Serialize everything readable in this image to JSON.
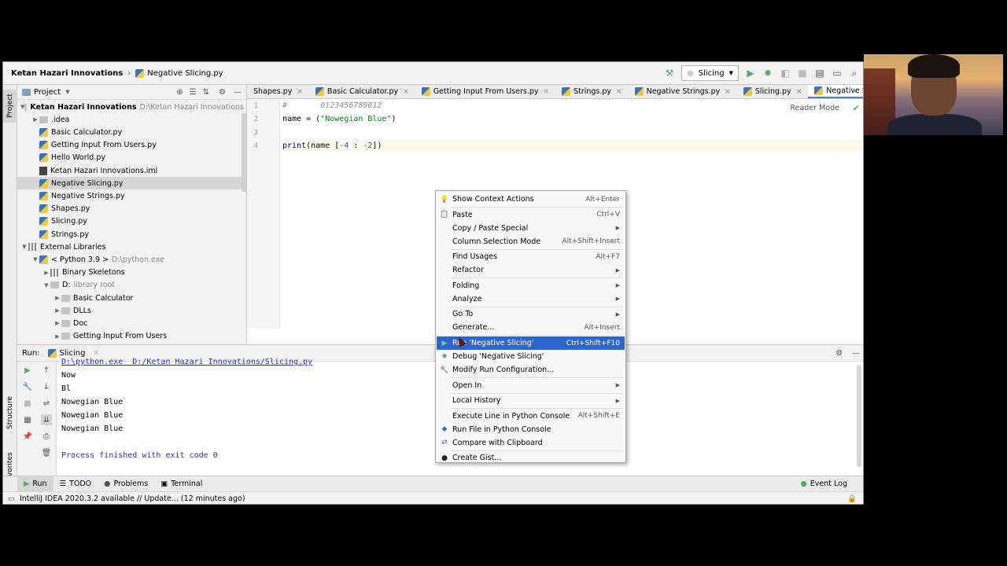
{
  "navbar": {
    "project": "Ketan Hazari Innovations",
    "file": "Negative Slicing.py",
    "run_config": "Slicing"
  },
  "left_strip": {
    "project": "Project",
    "structure": "Structure",
    "favorites": "Favorites"
  },
  "project_panel": {
    "title": "Project",
    "tree": [
      {
        "label": "Ketan Hazari Innovations",
        "note": "D:\\Ketan Hazari Innovations",
        "level": 0,
        "kind": "root",
        "expanded": true
      },
      {
        "label": ".idea",
        "level": 1,
        "kind": "folder",
        "expanded": false
      },
      {
        "label": "Basic Calculator.py",
        "level": 1,
        "kind": "py"
      },
      {
        "label": "Getting Input From Users.py",
        "level": 1,
        "kind": "py"
      },
      {
        "label": "Hello World.py",
        "level": 1,
        "kind": "py"
      },
      {
        "label": "Ketan Hazari Innovations.iml",
        "level": 1,
        "kind": "iml"
      },
      {
        "label": "Negative Slicing.py",
        "level": 1,
        "kind": "py",
        "selected": true
      },
      {
        "label": "Negative Strings.py",
        "level": 1,
        "kind": "py"
      },
      {
        "label": "Shapes.py",
        "level": 1,
        "kind": "py"
      },
      {
        "label": "Slicing.py",
        "level": 1,
        "kind": "py"
      },
      {
        "label": "Strings.py",
        "level": 1,
        "kind": "py"
      },
      {
        "label": "External Libraries",
        "level": 0,
        "kind": "lib",
        "expanded": true
      },
      {
        "label": "< Python 3.9 >",
        "note": "D:\\python.exe",
        "level": 1,
        "kind": "py",
        "expanded": true
      },
      {
        "label": "Binary Skeletons",
        "level": 2,
        "kind": "lib",
        "expanded": false
      },
      {
        "label": "D:",
        "note": "library root",
        "level": 2,
        "kind": "folder",
        "expanded": true
      },
      {
        "label": "Basic Calculator",
        "level": 3,
        "kind": "folder",
        "expanded": false
      },
      {
        "label": "DLLs",
        "level": 3,
        "kind": "folder",
        "expanded": false
      },
      {
        "label": "Doc",
        "level": 3,
        "kind": "folder",
        "expanded": false
      },
      {
        "label": "Getting Input From Users",
        "level": 3,
        "kind": "folder",
        "expanded": false
      }
    ]
  },
  "editor_tabs": [
    {
      "label": "Shapes.py"
    },
    {
      "label": "Basic Calculator.py"
    },
    {
      "label": "Getting Input From Users.py"
    },
    {
      "label": "Strings.py"
    },
    {
      "label": "Negative Strings.py"
    },
    {
      "label": "Slicing.py"
    },
    {
      "label": "Negative Slicing.py",
      "active": true
    }
  ],
  "editor": {
    "reader_mode": "Reader Mode",
    "line_numbers": [
      "1",
      "2",
      "3",
      "4"
    ],
    "line1": "#       0123456789012",
    "line2_a": "name = (",
    "line2_str": "\"Nowegian Blue\"",
    "line2_b": ")",
    "line4_fn": "print",
    "line4_a": "(name [",
    "line4_n1": "-4",
    "line4_b": " : ",
    "line4_n2": "-2",
    "line4_c": "])"
  },
  "run_panel": {
    "label": "Run:",
    "config": "Slicing",
    "output_path": "D:\\python.exe  D:/Ketan Hazari Innovations/Slicing.py",
    "output": [
      "Now",
      "Bl",
      "Nowegian Blue",
      "Nowegian Blue",
      "Nowegian Blue",
      "",
      "Process finished with exit code 0"
    ]
  },
  "tool_windows": {
    "run": "Run",
    "todo": "TODO",
    "problems": "Problems",
    "terminal": "Terminal",
    "event_log": "Event Log"
  },
  "status": {
    "text": "IntelliJ IDEA 2020.3.2 available // Update... (12 minutes ago)"
  },
  "context_menu": {
    "items": [
      {
        "label": "Show Context Actions",
        "shortcut": "Alt+Enter",
        "icon": "bulb-icon"
      },
      {
        "sep": true
      },
      {
        "label": "Paste",
        "shortcut": "Ctrl+V",
        "icon": "clipboard-icon"
      },
      {
        "label": "Copy / Paste Special",
        "submenu": true
      },
      {
        "label": "Column Selection Mode",
        "shortcut": "Alt+Shift+Insert"
      },
      {
        "sep": true
      },
      {
        "label": "Find Usages",
        "shortcut": "Alt+F7"
      },
      {
        "label": "Refactor",
        "submenu": true
      },
      {
        "sep": true
      },
      {
        "label": "Folding",
        "submenu": true
      },
      {
        "label": "Analyze",
        "submenu": true
      },
      {
        "sep": true
      },
      {
        "label": "Go To",
        "submenu": true
      },
      {
        "label": "Generate...",
        "shortcut": "Alt+Insert"
      },
      {
        "sep": true
      },
      {
        "label": "Run 'Negative Slicing'",
        "shortcut": "Ctrl+Shift+F10",
        "icon": "run-icon",
        "highlighted": true
      },
      {
        "label": "Debug 'Negative Slicing'",
        "icon": "debug-icon"
      },
      {
        "label": "Modify Run Configuration...",
        "icon": "wrench-icon"
      },
      {
        "sep": true
      },
      {
        "label": "Open In",
        "submenu": true
      },
      {
        "sep": true
      },
      {
        "label": "Local History",
        "submenu": true
      },
      {
        "sep": true
      },
      {
        "label": "Execute Line in Python Console",
        "shortcut": "Alt+Shift+E"
      },
      {
        "label": "Run File in Python Console",
        "icon": "python-icon"
      },
      {
        "label": "Compare with Clipboard",
        "icon": "compare-icon"
      },
      {
        "sep": true
      },
      {
        "label": "Create Gist...",
        "icon": "github-icon"
      }
    ]
  },
  "colors": {
    "highlight": "#2f65ca",
    "active_tab": "#4083c9",
    "run_green": "#59a869"
  }
}
